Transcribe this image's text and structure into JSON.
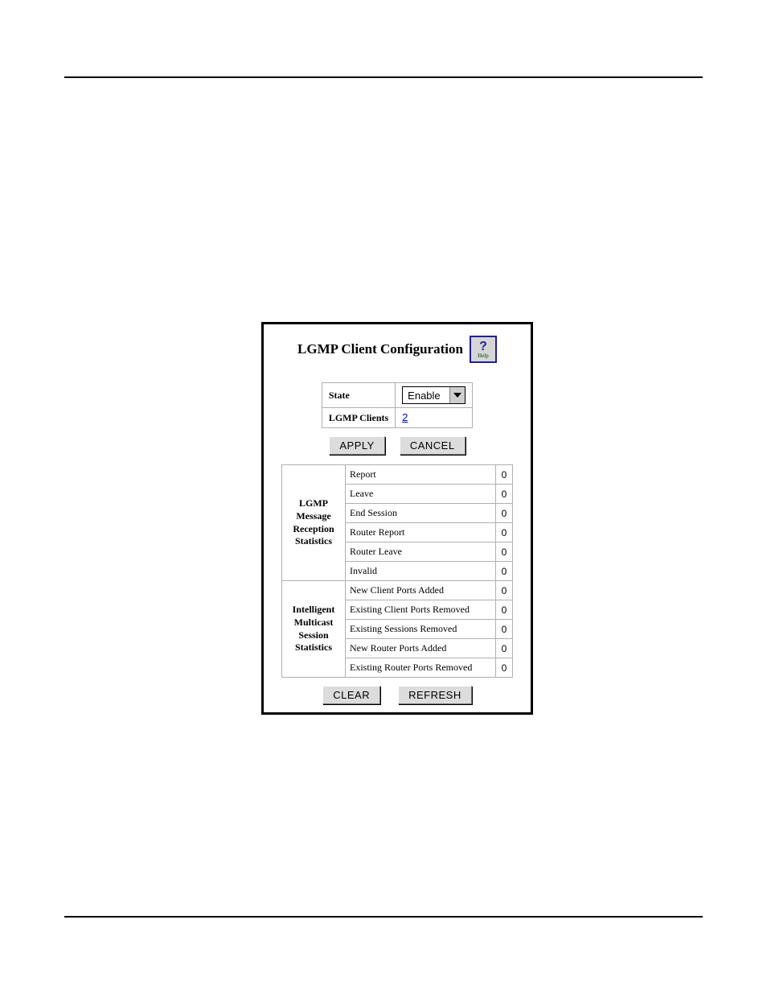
{
  "panel": {
    "title": "LGMP Client Configuration",
    "help_label": "Help"
  },
  "config": {
    "state_label": "State",
    "state_value": "Enable",
    "clients_label": "LGMP Clients",
    "clients_value": "2"
  },
  "buttons": {
    "apply": "APPLY",
    "cancel": "CANCEL",
    "clear": "CLEAR",
    "refresh": "REFRESH"
  },
  "stats": {
    "reception": {
      "group_label": "LGMP Message Reception Statistics",
      "rows": [
        {
          "label": "Report",
          "value": "0"
        },
        {
          "label": "Leave",
          "value": "0"
        },
        {
          "label": "End Session",
          "value": "0"
        },
        {
          "label": "Router Report",
          "value": "0"
        },
        {
          "label": "Router Leave",
          "value": "0"
        },
        {
          "label": "Invalid",
          "value": "0"
        }
      ]
    },
    "session": {
      "group_label": "Intelligent Multicast Session Statistics",
      "rows": [
        {
          "label": "New Client Ports Added",
          "value": "0"
        },
        {
          "label": "Existing Client Ports Removed",
          "value": "0"
        },
        {
          "label": "Existing Sessions Removed",
          "value": "0"
        },
        {
          "label": "New Router Ports Added",
          "value": "0"
        },
        {
          "label": "Existing Router Ports Removed",
          "value": "0"
        }
      ]
    }
  }
}
